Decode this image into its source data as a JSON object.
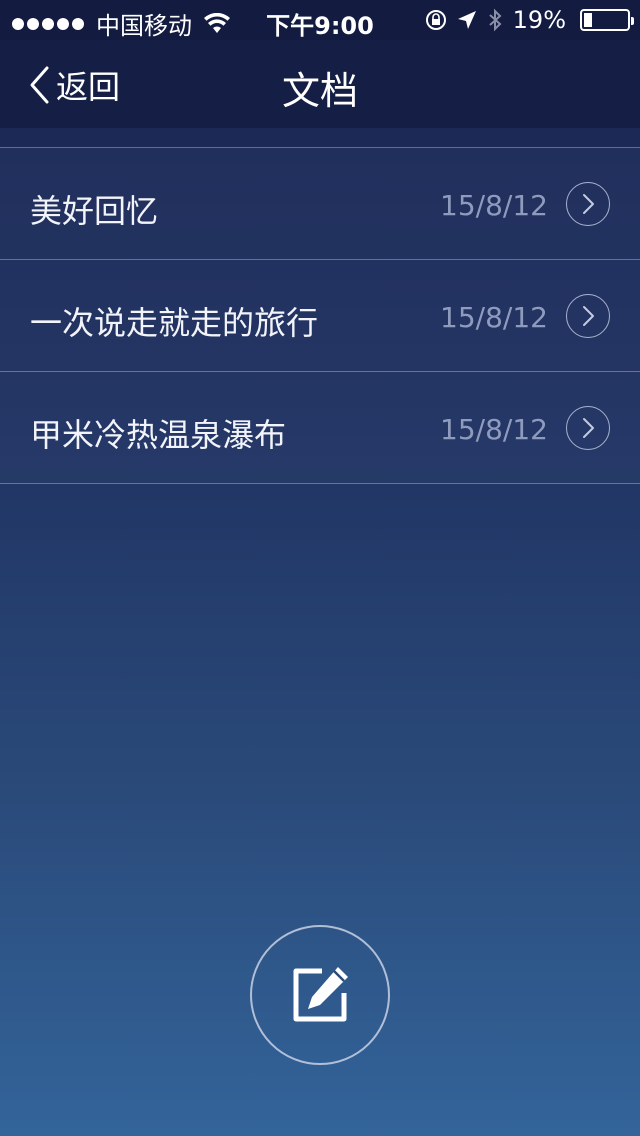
{
  "status_bar": {
    "carrier": "中国移动",
    "time": "下午9:00",
    "battery": "19%",
    "battery_level": 0.19,
    "icons": [
      "signal-dots",
      "wifi-icon",
      "orientation-lock-icon",
      "location-icon",
      "bluetooth-icon",
      "battery-icon"
    ]
  },
  "nav": {
    "back_label": "返回",
    "title": "文档"
  },
  "documents": [
    {
      "title": "美好回忆",
      "date": "15/8/12"
    },
    {
      "title": "一次说走就走的旅行",
      "date": "15/8/12"
    },
    {
      "title": "甲米冷热温泉瀑布",
      "date": "15/8/12"
    }
  ],
  "compose_button": {
    "icon": "compose-icon"
  },
  "colors": {
    "nav_background": "#151f45",
    "gradient_top": "#1a2450",
    "gradient_bottom": "#33649a",
    "date_text": "#8f9bbd"
  }
}
